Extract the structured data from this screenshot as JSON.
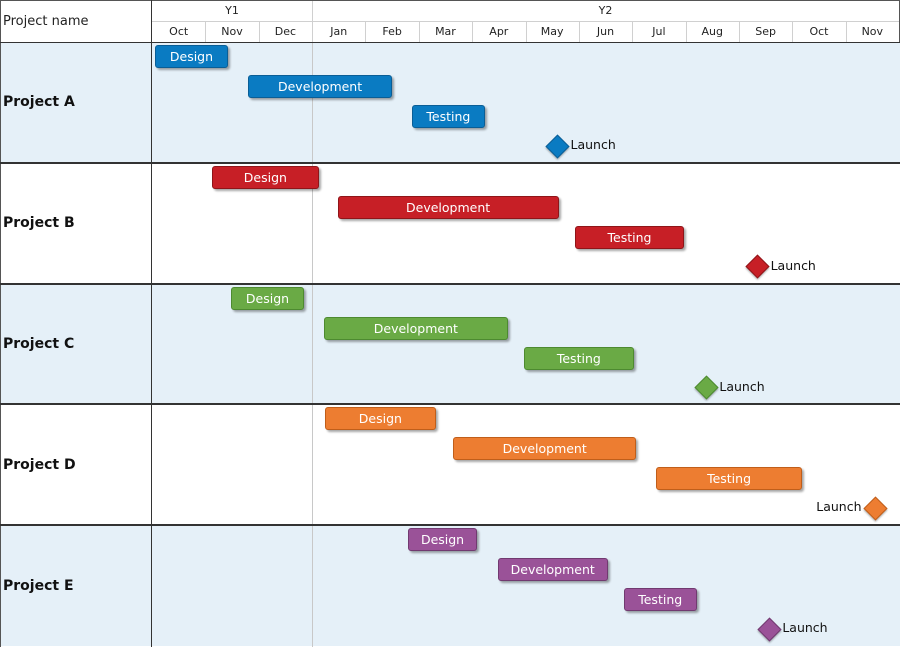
{
  "chart_data": {
    "type": "gantt",
    "title": "",
    "header": {
      "column_label": "Project name"
    },
    "years": [
      {
        "label": "Y1",
        "start_month": 0,
        "months": 3
      },
      {
        "label": "Y2",
        "start_month": 3,
        "months": 11
      }
    ],
    "months": [
      "Oct",
      "Nov",
      "Dec",
      "Jan",
      "Feb",
      "Mar",
      "Apr",
      "May",
      "Jun",
      "Jul",
      "Aug",
      "Sep",
      "Oct",
      "Nov"
    ],
    "x_unit": "months from start of Oct Y1",
    "xlim": [
      0,
      14
    ],
    "projects": [
      {
        "name": "Project A",
        "color": "#0a7bc2",
        "border": "#0a5e96",
        "row_bg": "#e5f0f8",
        "tasks": [
          {
            "label": "Design",
            "start": 0.05,
            "end": 1.43
          },
          {
            "label": "Development",
            "start": 1.8,
            "end": 4.5
          },
          {
            "label": "Testing",
            "start": 4.87,
            "end": 6.24
          }
        ],
        "milestone": {
          "label": "Launch",
          "at": 7.6,
          "label_side": "right"
        }
      },
      {
        "name": "Project B",
        "color": "#c71f26",
        "border": "#8f1519",
        "row_bg": "#ffffff",
        "tasks": [
          {
            "label": "Design",
            "start": 1.12,
            "end": 3.13
          },
          {
            "label": "Development",
            "start": 3.48,
            "end": 7.62
          },
          {
            "label": "Testing",
            "start": 7.92,
            "end": 9.98
          }
        ],
        "milestone": {
          "label": "Launch",
          "at": 11.35,
          "label_side": "right"
        }
      },
      {
        "name": "Project C",
        "color": "#6aaa45",
        "border": "#4d8a30",
        "row_bg": "#e5f0f8",
        "tasks": [
          {
            "label": "Design",
            "start": 1.48,
            "end": 2.85
          },
          {
            "label": "Development",
            "start": 3.22,
            "end": 6.67
          },
          {
            "label": "Testing",
            "start": 6.97,
            "end": 9.03
          }
        ],
        "milestone": {
          "label": "Launch",
          "at": 10.39,
          "label_side": "right"
        }
      },
      {
        "name": "Project D",
        "color": "#ed7d31",
        "border": "#c05e1a",
        "row_bg": "#ffffff",
        "tasks": [
          {
            "label": "Design",
            "start": 3.24,
            "end": 5.32
          },
          {
            "label": "Development",
            "start": 5.64,
            "end": 9.08
          },
          {
            "label": "Testing",
            "start": 9.44,
            "end": 12.19
          }
        ],
        "milestone": {
          "label": "Launch",
          "at": 13.56,
          "label_side": "left"
        }
      },
      {
        "name": "Project E",
        "color": "#9a5298",
        "border": "#713a70",
        "row_bg": "#e5f0f8",
        "tasks": [
          {
            "label": "Design",
            "start": 4.79,
            "end": 6.1
          },
          {
            "label": "Development",
            "start": 6.48,
            "end": 8.54
          },
          {
            "label": "Testing",
            "start": 8.84,
            "end": 10.21
          }
        ],
        "milestone": {
          "label": "Launch",
          "at": 11.57,
          "label_side": "right"
        }
      }
    ]
  }
}
